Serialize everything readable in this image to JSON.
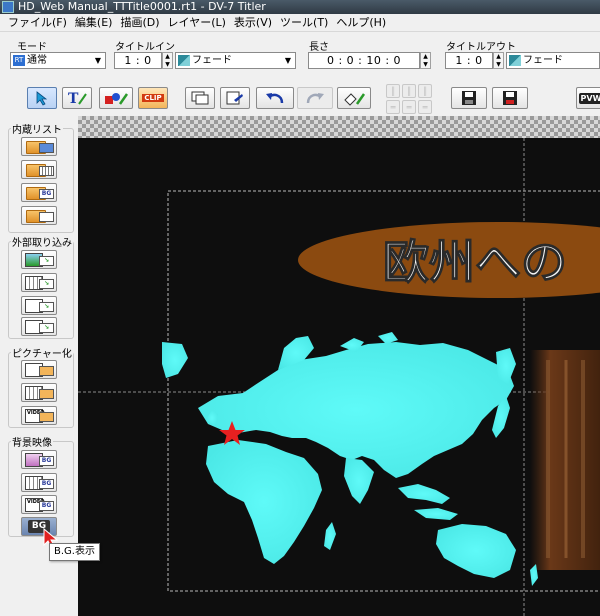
{
  "window": {
    "title": "HD_Web Manual_TTTitle0001.rt1 - DV-7 Titler"
  },
  "menu": [
    "ファイル(F)",
    "編集(E)",
    "描画(D)",
    "レイヤー(L)",
    "表示(V)",
    "ツール(T)",
    "ヘルプ(H)"
  ],
  "props": {
    "mode_label": "モード",
    "mode_value": "通常",
    "mode_icon_text": "RT",
    "title_in_label": "タイトルイン",
    "title_in_value": "1 : 0",
    "title_in_effect": "フェード",
    "length_label": "長さ",
    "length_value": "0 : 0 : 10 : 0",
    "title_out_label": "タイトルアウト",
    "title_out_value": "1 : 0",
    "title_out_effect": "フェード"
  },
  "toolbar": {
    "clip_label": "CLIP",
    "pvw_label": "PVW"
  },
  "sidebar": {
    "groups": [
      {
        "label": "内蔵リスト"
      },
      {
        "label": "外部取り込み"
      },
      {
        "label": "ピクチャー化"
      },
      {
        "label": "背景映像"
      }
    ],
    "bg_badge": "BG",
    "video_text": "VIDEO",
    "bg_show_label": "BG"
  },
  "canvas": {
    "title_text": "欧州への"
  },
  "tooltip": {
    "text": "B.G.表示"
  },
  "colors": {
    "ellipse": "#8b4a10",
    "map": "#5ffaf8",
    "star": "#e82020"
  }
}
